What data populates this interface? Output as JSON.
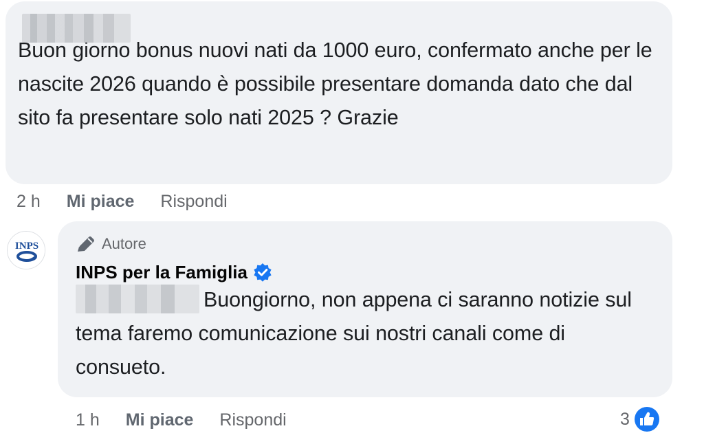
{
  "comment1": {
    "text": "Buon giorno bonus nuovi nati da 1000 euro, confermato anche per le nascite 2026 quando è possibile presentare domanda dato che dal sito fa presentare solo nati 2025 ? Grazie",
    "time": "2 h",
    "like_label": "Mi piace",
    "reply_label": "Rispondi"
  },
  "comment2": {
    "badge_label": "Autore",
    "badge_icon": "pencil-icon",
    "author_name": "INPS per la Famiglia",
    "verified_icon": "verified-badge-icon",
    "verified_color": "#1877f2",
    "avatar_text": "INPS",
    "text": "Buongiorno, non appena ci saranno notizie sul tema faremo comunicazione sui nostri canali come di consueto.",
    "time": "1 h",
    "like_label": "Mi piace",
    "reply_label": "Rispondi",
    "reaction_count": "3",
    "reaction_icon": "like-reaction-icon",
    "reaction_color": "#1877f2"
  },
  "colors": {
    "bubble": "#f0f2f5",
    "secondary_text": "#65676b",
    "primary_text": "#050505",
    "accent": "#1877f2"
  }
}
